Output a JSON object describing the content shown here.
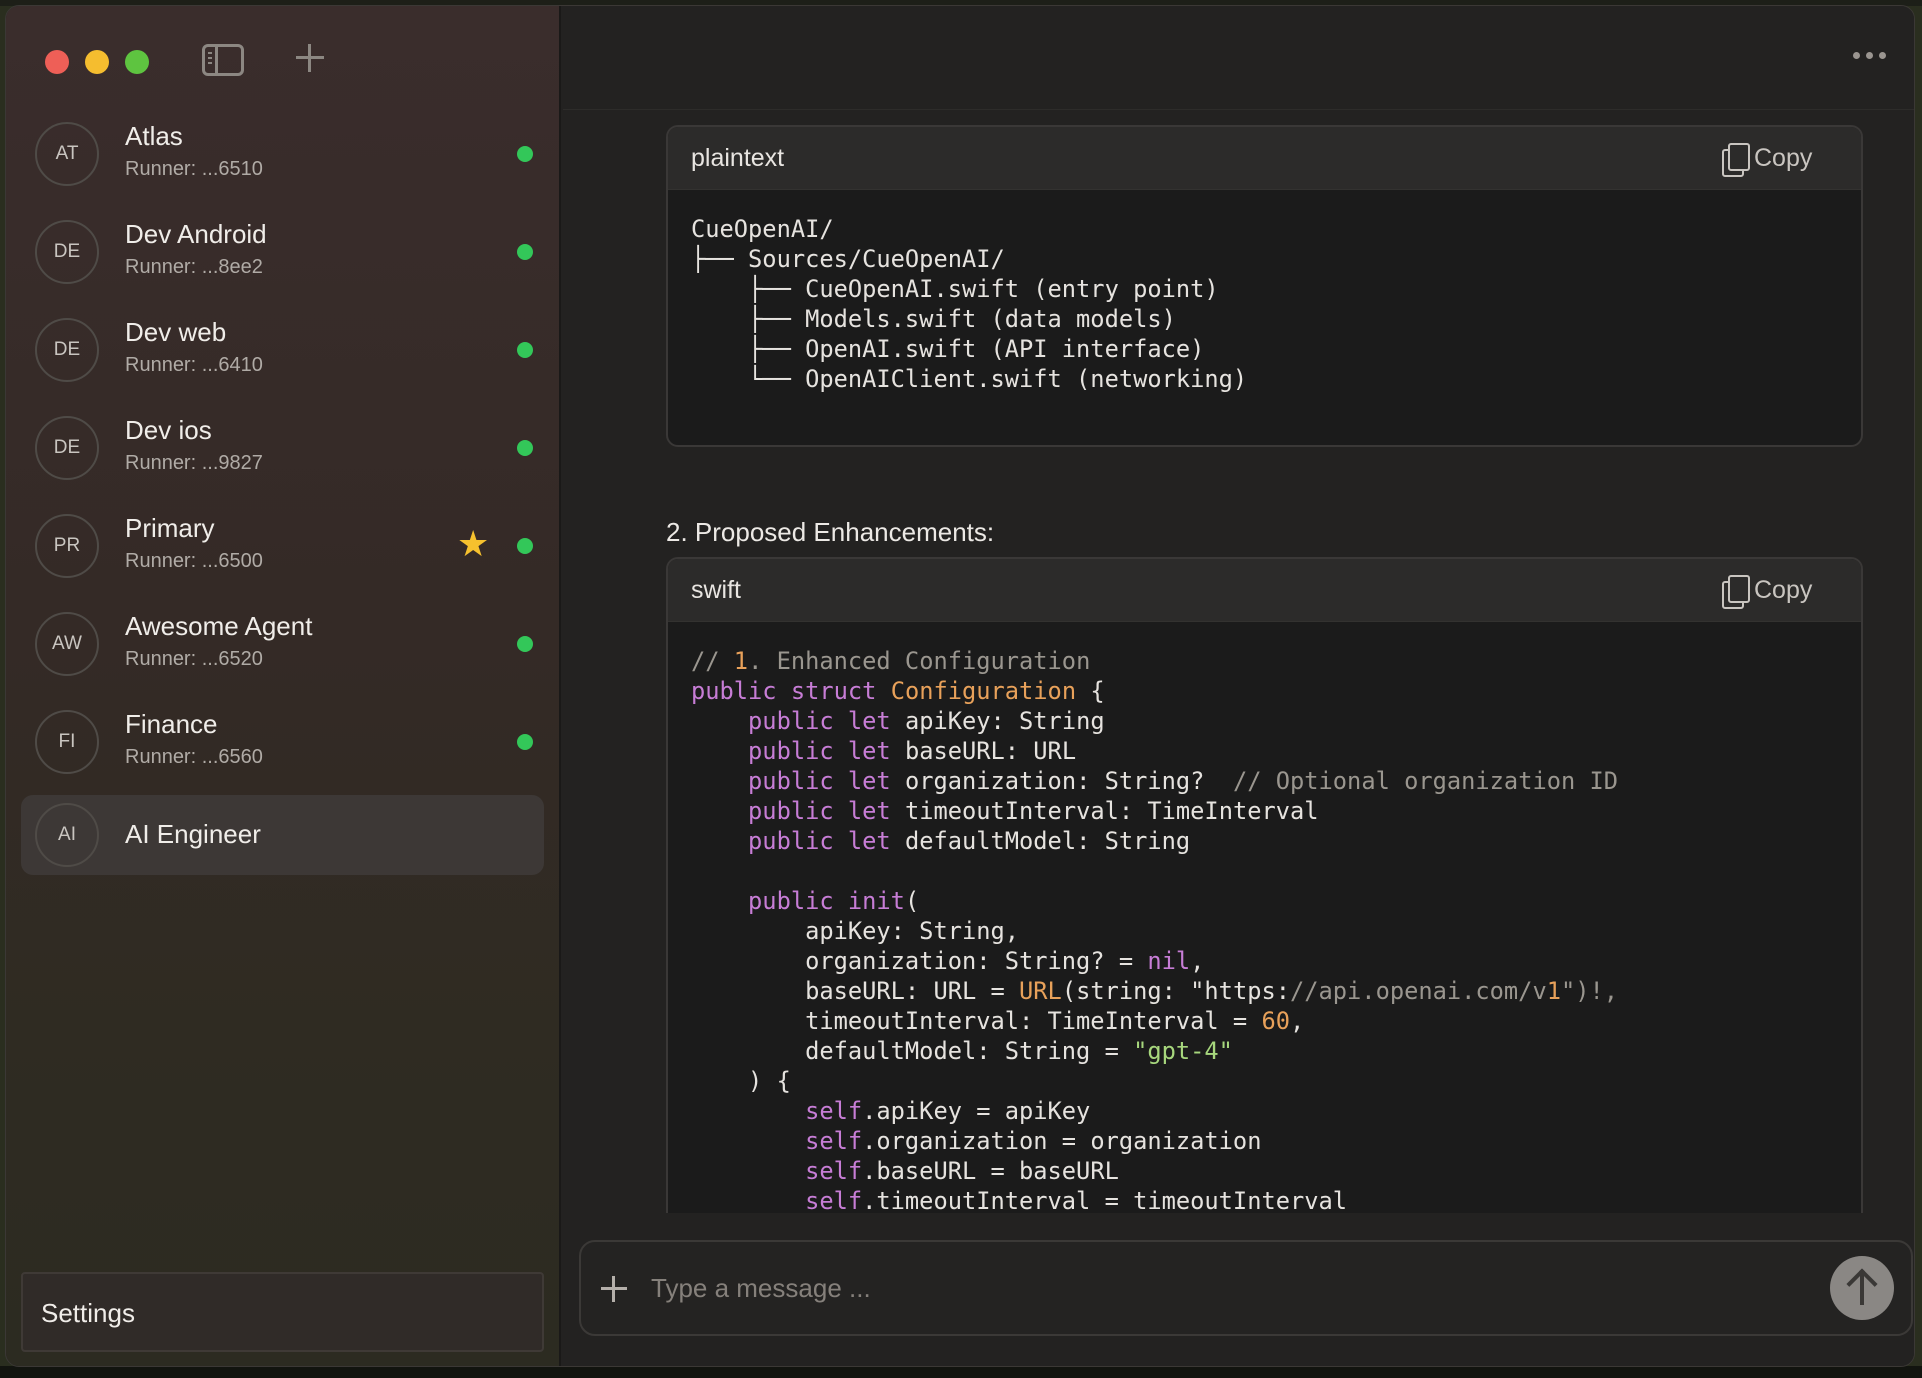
{
  "window": {
    "controls": [
      "close",
      "minimize",
      "zoom"
    ]
  },
  "sidebar": {
    "agents": [
      {
        "initials": "AT",
        "name": "Atlas",
        "runner": "Runner: ...6510",
        "online": true,
        "starred": false
      },
      {
        "initials": "DE",
        "name": "Dev Android",
        "runner": "Runner: ...8ee2",
        "online": true,
        "starred": false
      },
      {
        "initials": "DE",
        "name": "Dev web",
        "runner": "Runner: ...6410",
        "online": true,
        "starred": false
      },
      {
        "initials": "DE",
        "name": "Dev ios",
        "runner": "Runner: ...9827",
        "online": true,
        "starred": false
      },
      {
        "initials": "PR",
        "name": "Primary",
        "runner": "Runner: ...6500",
        "online": true,
        "starred": true
      },
      {
        "initials": "AW",
        "name": "Awesome Agent",
        "runner": "Runner: ...6520",
        "online": true,
        "starred": false
      },
      {
        "initials": "FI",
        "name": "Finance",
        "runner": "Runner: ...6560",
        "online": true,
        "starred": false
      },
      {
        "initials": "AI",
        "name": "AI Engineer",
        "runner": "",
        "online": false,
        "starred": false,
        "selected": true
      }
    ],
    "settings_label": "Settings"
  },
  "main": {
    "code_blocks": [
      {
        "language": "plaintext",
        "copy_label": "Copy",
        "lines": [
          "CueOpenAI/",
          "├── Sources/CueOpenAI/",
          "    ├── CueOpenAI.swift (entry point)",
          "    ├── Models.swift (data models)",
          "    ├── OpenAI.swift (API interface)",
          "    └── OpenAIClient.swift (networking)"
        ]
      },
      {
        "language": "swift",
        "copy_label": "Copy",
        "lines": [
          "// 1. Enhanced Configuration",
          "public struct Configuration {",
          "    public let apiKey: String",
          "    public let baseURL: URL",
          "    public let organization: String?  // Optional organization ID",
          "    public let timeoutInterval: TimeInterval",
          "    public let defaultModel: String",
          "",
          "    public init(",
          "        apiKey: String,",
          "        organization: String? = nil,",
          "        baseURL: URL = URL(string: \"https://api.openai.com/v1\")!,",
          "        timeoutInterval: TimeInterval = 60,",
          "        defaultModel: String = \"gpt-4\"",
          "    ) {",
          "        self.apiKey = apiKey",
          "        self.organization = organization",
          "        self.baseURL = baseURL",
          "        self.timeoutInterval = timeoutInterval"
        ]
      }
    ],
    "section_title": "2. Proposed Enhancements:"
  },
  "composer": {
    "placeholder": "Type a message ...",
    "value": ""
  },
  "colors": {
    "online": "#33c759",
    "star": "#f6c12e",
    "keyword": "#c77dd6",
    "type": "#e8a15a",
    "string": "#a7d77d",
    "comment": "#9a968f"
  },
  "icons": [
    "sidebar-toggle-icon",
    "plus-icon",
    "more-icon",
    "copy-icon",
    "star-icon",
    "send-arrow-icon"
  ]
}
